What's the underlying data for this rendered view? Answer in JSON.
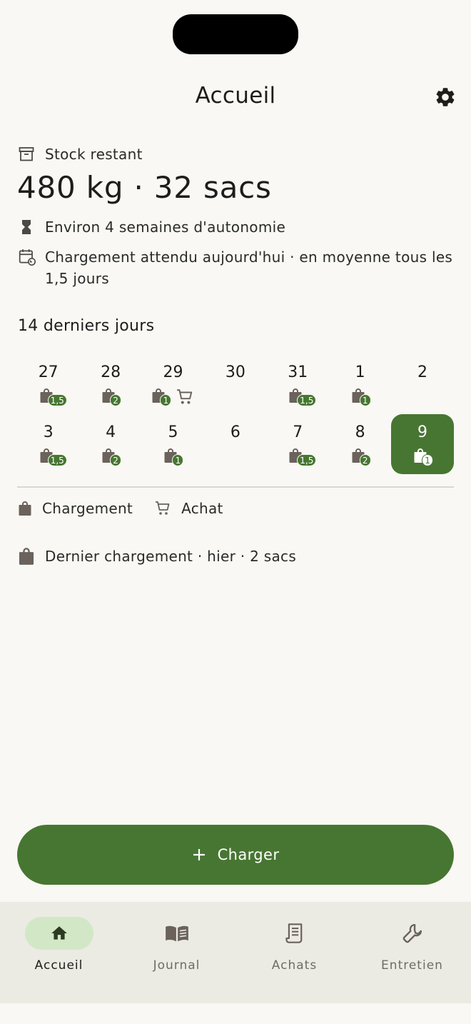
{
  "header": {
    "title": "Accueil"
  },
  "stock": {
    "label": "Stock restant",
    "value": "480 kg · 32 sacs",
    "autonomy": "Environ 4 semaines d'autonomie",
    "next_load_line1": "Chargement attendu aujourd'hui · en moyenne tous les",
    "next_load_line2": "1,5 jours"
  },
  "history": {
    "title": "14 derniers jours",
    "days": [
      {
        "day": "27",
        "bags": "1,5",
        "purchase": false
      },
      {
        "day": "28",
        "bags": "2",
        "purchase": false
      },
      {
        "day": "29",
        "bags": "1",
        "purchase": true
      },
      {
        "day": "30",
        "bags": "",
        "purchase": false
      },
      {
        "day": "31",
        "bags": "1,5",
        "purchase": false
      },
      {
        "day": "1",
        "bags": "1",
        "purchase": false
      },
      {
        "day": "2",
        "bags": "",
        "purchase": false
      },
      {
        "day": "3",
        "bags": "1,5",
        "purchase": false
      },
      {
        "day": "4",
        "bags": "2",
        "purchase": false
      },
      {
        "day": "5",
        "bags": "1",
        "purchase": false
      },
      {
        "day": "6",
        "bags": "",
        "purchase": false
      },
      {
        "day": "7",
        "bags": "1,5",
        "purchase": false
      },
      {
        "day": "8",
        "bags": "2",
        "purchase": false
      },
      {
        "day": "9",
        "bags": "1",
        "purchase": false,
        "selected": true
      }
    ]
  },
  "legend": {
    "load_label": "Chargement",
    "purchase_label": "Achat"
  },
  "last_load": {
    "text": "Dernier chargement · hier · 2 sacs"
  },
  "fab": {
    "label": "Charger"
  },
  "nav": {
    "items": [
      {
        "label": "Accueil",
        "icon": "home-icon",
        "active": true
      },
      {
        "label": "Journal",
        "icon": "book-icon",
        "active": false
      },
      {
        "label": "Achats",
        "icon": "receipt-icon",
        "active": false
      },
      {
        "label": "Entretien",
        "icon": "wrench-icon",
        "active": false
      }
    ]
  },
  "colors": {
    "primary": "#477632",
    "background": "#f9f8f4",
    "nav_bg": "#ebebe4",
    "active_pill": "#d2e7c6",
    "icon_gray": "#6b625c"
  }
}
